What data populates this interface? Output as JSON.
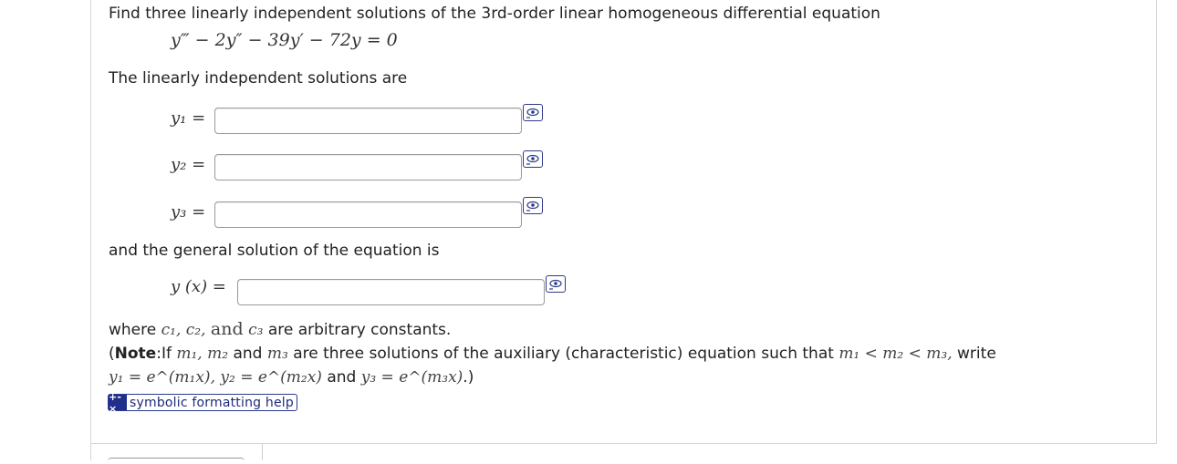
{
  "question": {
    "prompt": "Find three linearly independent solutions of the 3rd-order linear homogeneous differential equation",
    "equation": "y‴ − 2y″ − 39y′ − 72y = 0",
    "solutions_intro": "The linearly independent solutions are",
    "labels": [
      "y₁ =",
      "y₂ =",
      "y₃ ="
    ],
    "general_intro": "and the general solution of the equation is",
    "general_label": "y (x) =",
    "where_text": {
      "prefix": "where",
      "constants": "c₁, c₂,",
      "and": "and",
      "c3": "c₃",
      "suffix": "are arbitrary constants."
    },
    "note": {
      "open": "(",
      "bold": "Note",
      "lead": ":If",
      "m_list": "m₁, m₂",
      "and1": "and",
      "m3": "m₃",
      "middle": "are three solutions of the auxiliary (characteristic) equation such that",
      "order": "m₁ < m₂ < m₃,",
      "tail": "write",
      "line2_a": "y₁ = e^(m₁x), y₂ = e^(m₂x)",
      "line2_and": "and",
      "line2_b": "y₃ = e^(m₃x)",
      "close": ".)"
    }
  },
  "inputs": {
    "y1": "",
    "y2": "",
    "y3": "",
    "general": ""
  },
  "help": {
    "icon": "+-×",
    "label": "symbolic formatting help"
  },
  "icons": {
    "preview": "eye-preview-icon",
    "help": "symbolic-help-icon"
  },
  "colors": {
    "accent": "#2e3a8c",
    "help_icon_bg": "#1f2f8a",
    "text": "#222222"
  }
}
